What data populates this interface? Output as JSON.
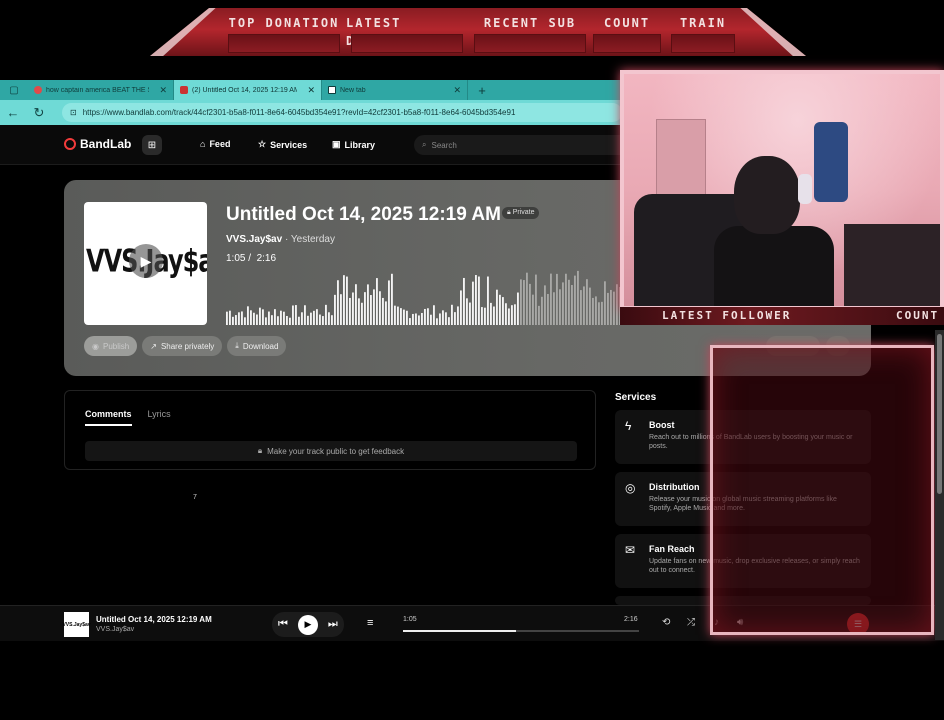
{
  "overlay": {
    "banner_labels": [
      "TOP DONATION",
      "LATEST DONATION",
      "RECENT SUB",
      "COUNT",
      "TRAIN"
    ],
    "cam_labels": {
      "follower": "LATEST FOLLOWER",
      "count": "COUNT"
    }
  },
  "browser": {
    "tabs": [
      {
        "title": "how captain america BEAT THE S..."
      },
      {
        "title": "(2) Untitled Oct 14, 2025 12:19 AM"
      },
      {
        "title": "New tab"
      }
    ],
    "url": "https://www.bandlab.com/track/44cf2301-b5a8-f011-8e64-6045bd354e91?revId=42cf2301-b5a8-f011-8e64-6045bd354e91"
  },
  "header": {
    "logo": "BandLab",
    "nav": [
      "Feed",
      "Services",
      "Library"
    ],
    "search_placeholder": "Search"
  },
  "track": {
    "cover_text": "VVS.Jay$av",
    "title": "Untitled Oct 14, 2025 12:19 AM",
    "privacy": "Private",
    "artist": "VVS.Jay$av",
    "when": "· Yesterday",
    "current_time": "1:05",
    "duration": "2:16",
    "buttons": {
      "publish": "Publish",
      "share": "Share privately",
      "download": "Download"
    }
  },
  "comments": {
    "tabs": [
      "Comments",
      "Lyrics"
    ],
    "notice": "Make your track public to get feedback",
    "stray": "7"
  },
  "services": {
    "heading": "Services",
    "items": [
      {
        "title": "Boost",
        "desc": "Reach out to millions of BandLab users by boosting your music or posts."
      },
      {
        "title": "Distribution",
        "desc": "Release your music on global music streaming platforms like Spotify, Apple Music and more."
      },
      {
        "title": "Fan Reach",
        "desc": "Update fans on new music, drop exclusive releases, or simply reach out to connect."
      }
    ]
  },
  "player": {
    "title": "Untitled Oct 14, 2025 12:19 AM",
    "artist": "VVS.Jay$av",
    "thumb_text": "VVS.Jay$av",
    "current": "1:05",
    "total": "2:16",
    "progress": 0.48
  },
  "colors": {
    "accent": "#f23b3b",
    "overlay_red": "#b3262d",
    "tab_teal": "#2fa7a4"
  }
}
